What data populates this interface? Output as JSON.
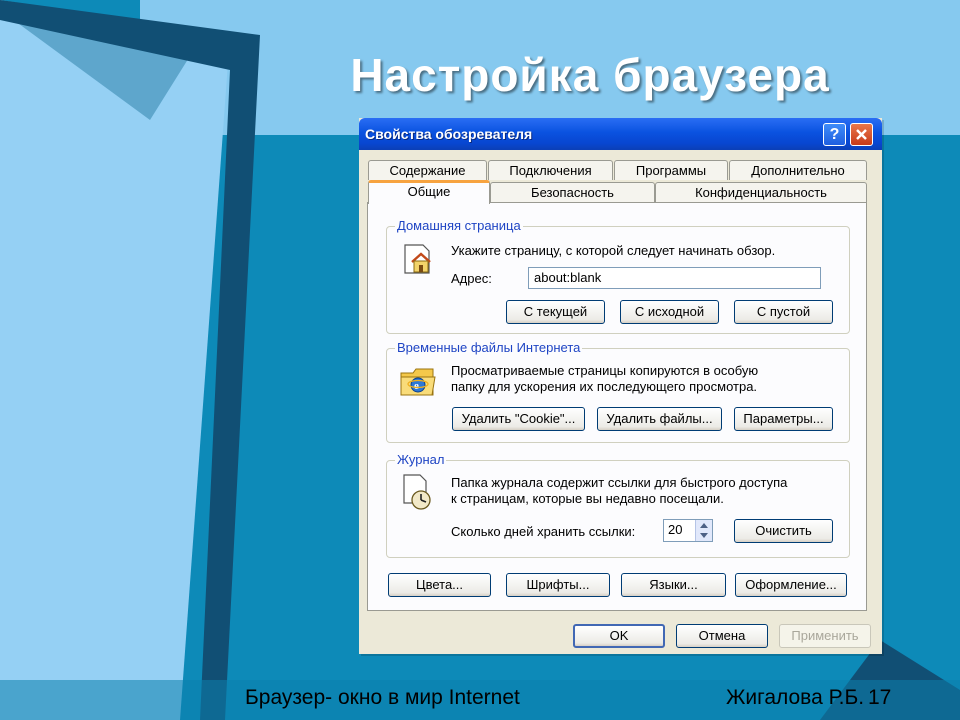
{
  "slide": {
    "title": "Настройка браузера",
    "footer_left": "Браузер- окно в мир Internet",
    "footer_right": "Жигалова Р.Б.",
    "page_number": "17"
  },
  "dialog": {
    "title": "Свойства обозревателя",
    "help_label": "?",
    "close_label": "✕",
    "tabs_back": [
      "Содержание",
      "Подключения",
      "Программы",
      "Дополнительно"
    ],
    "tabs_front": [
      "Общие",
      "Безопасность",
      "Конфиденциальность"
    ],
    "active_tab": "Общие",
    "home": {
      "group_title": "Домашняя страница",
      "description": "Укажите страницу, с которой следует начинать обзор.",
      "address_label": "Адрес:",
      "address_value": "about:blank",
      "btn_current": "С текущей",
      "btn_default": "С исходной",
      "btn_blank": "С пустой"
    },
    "temp": {
      "group_title": "Временные файлы Интернета",
      "description_line1": "Просматриваемые страницы копируются в особую",
      "description_line2": "папку для ускорения их последующего просмотра.",
      "btn_cookies": "Удалить \"Cookie\"...",
      "btn_files": "Удалить файлы...",
      "btn_settings": "Параметры..."
    },
    "history": {
      "group_title": "Журнал",
      "description_line1": "Папка журнала содержит ссылки для быстрого доступа",
      "description_line2": "к страницам, которые вы недавно посещали.",
      "days_label": "Сколько дней хранить ссылки:",
      "days_value": "20",
      "btn_clear": "Очистить"
    },
    "bottom_buttons": {
      "colors": "Цвета...",
      "fonts": "Шрифты...",
      "languages": "Языки...",
      "accessibility": "Оформление..."
    },
    "ok": "OK",
    "cancel": "Отмена",
    "apply": "Применить"
  },
  "colors": {
    "titlebar": "#0a52e0",
    "group_title": "#1f45c4",
    "active_tab_accent": "#f7a340",
    "slide_background": "#0d8ab8"
  },
  "icons": {
    "home": "house-page-icon",
    "temp": "ie-folder-icon",
    "history": "clock-page-icon",
    "spinner": "spinner-arrows-icon"
  }
}
